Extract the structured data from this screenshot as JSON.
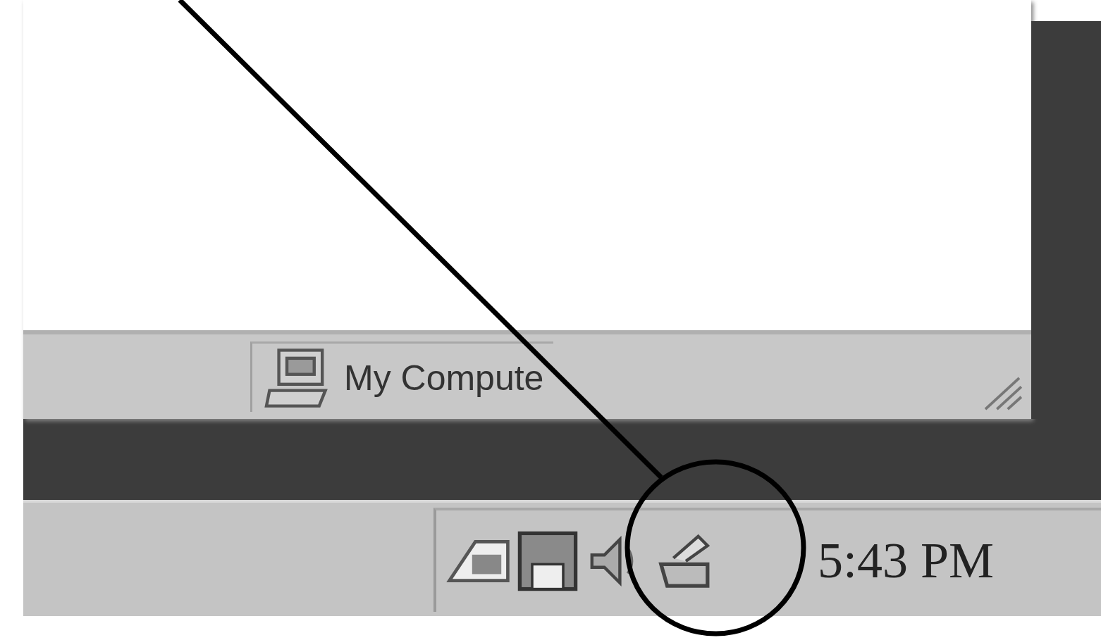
{
  "window": {
    "status_bar": {
      "location": "My Compute"
    }
  },
  "taskbar": {
    "clock": "5:43 PM"
  }
}
